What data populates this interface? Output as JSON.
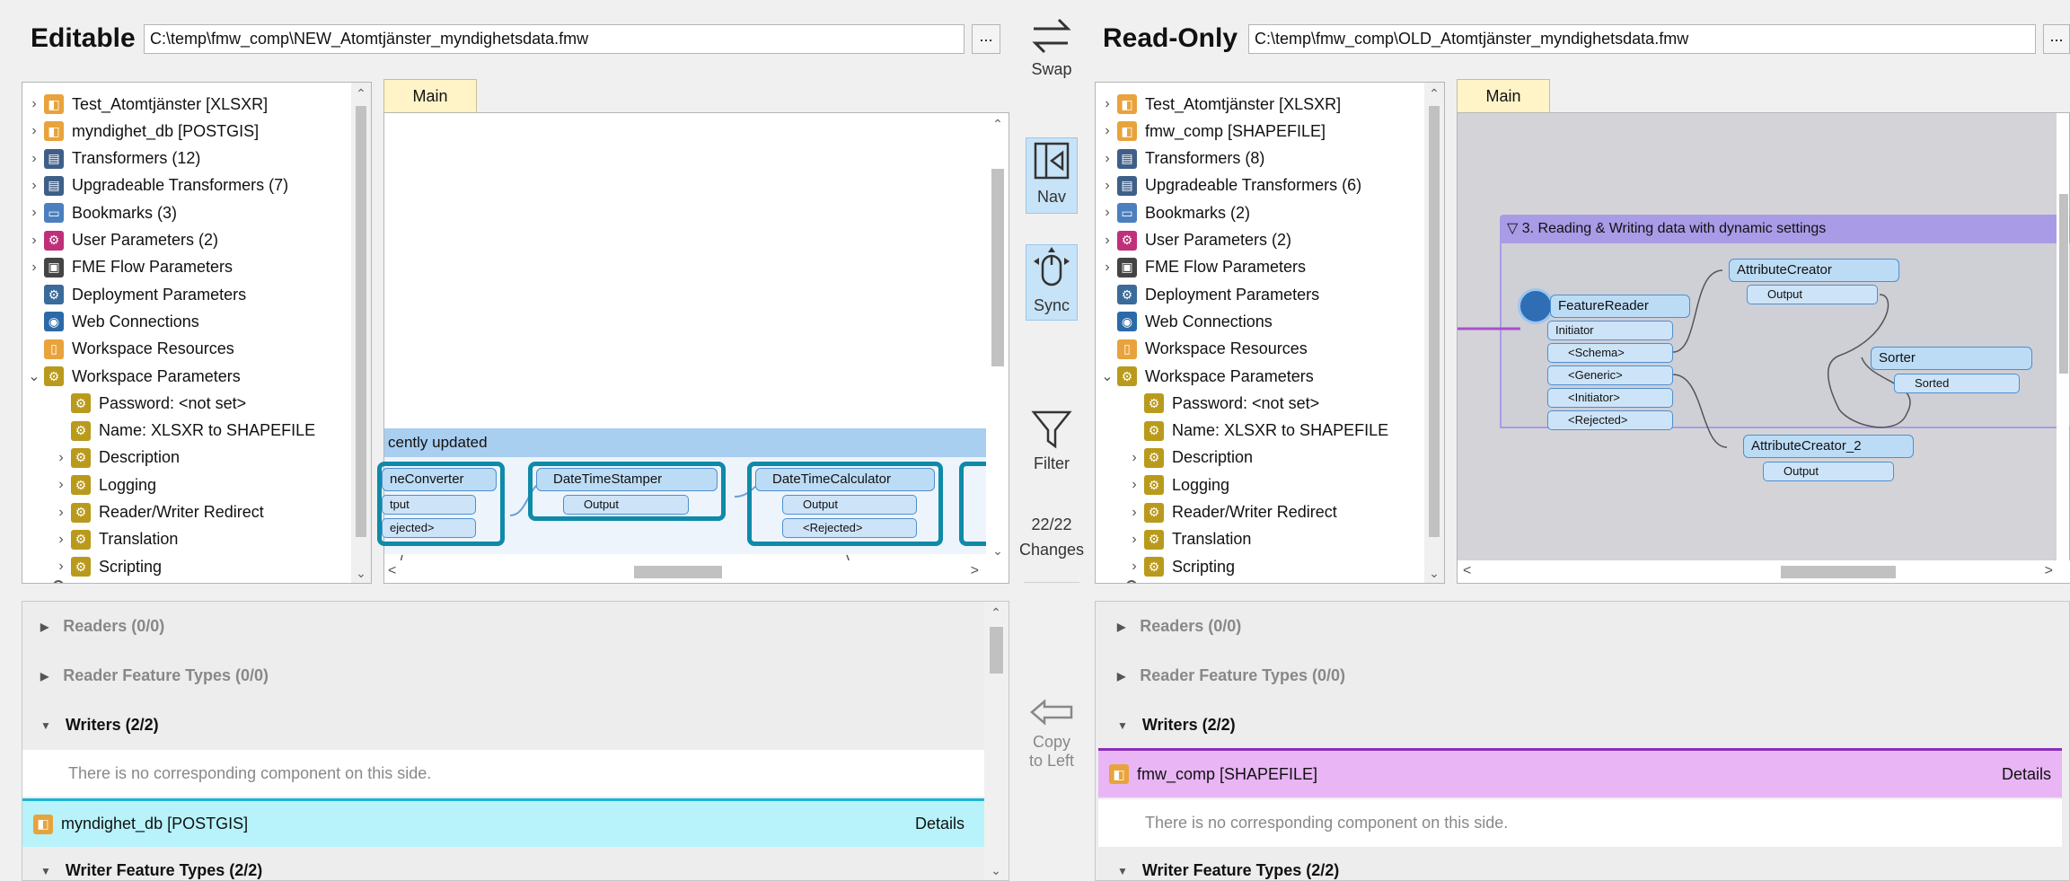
{
  "left": {
    "title": "Editable",
    "path": "C:\\temp\\fmw_comp\\NEW_Atomtjänster_myndighetsdata.fmw",
    "browse": "...",
    "tree": [
      {
        "label": "Test_Atomtjänster [XLSXR]",
        "chev": ">"
      },
      {
        "label": "myndighet_db [POSTGIS]",
        "chev": ">"
      },
      {
        "label": "Transformers (12)",
        "chev": ">"
      },
      {
        "label": "Upgradeable Transformers (7)",
        "chev": ">"
      },
      {
        "label": "Bookmarks (3)",
        "chev": ">"
      },
      {
        "label": "User Parameters (2)",
        "chev": ">"
      },
      {
        "label": "FME Flow Parameters",
        "chev": ">"
      },
      {
        "label": "Deployment Parameters",
        "chev": ""
      },
      {
        "label": "Web Connections",
        "chev": ""
      },
      {
        "label": "Workspace Resources",
        "chev": ""
      },
      {
        "label": "Workspace Parameters",
        "chev": "v"
      },
      {
        "label": "Password: <not set>",
        "chev": ""
      },
      {
        "label": "Name: XLSXR to SHAPEFILE",
        "chev": ""
      },
      {
        "label": "Description",
        "chev": ">"
      },
      {
        "label": "Logging",
        "chev": ">"
      },
      {
        "label": "Reader/Writer Redirect",
        "chev": ">"
      },
      {
        "label": "Translation",
        "chev": ">"
      },
      {
        "label": "Scripting",
        "chev": ">"
      }
    ],
    "tab": "Main",
    "canvas": {
      "bookmark": "cently updated",
      "node1": "neConverter",
      "node1_ports": [
        "tput",
        "ejected>"
      ],
      "node2": "DateTimeStamper",
      "node2_ports": [
        "Output"
      ],
      "node3": "DateTimeCalculator",
      "node3_ports": [
        "Output",
        "<Rejected>"
      ]
    },
    "sections": {
      "readers": "Readers (0/0)",
      "reader_ft": "Reader Feature Types (0/0)",
      "writers": "Writers (2/2)",
      "no_comp": "There is no corresponding component on this side.",
      "writer_item": "myndighet_db [POSTGIS]",
      "details": "Details",
      "writer_ft": "Writer Feature Types (2/2)"
    }
  },
  "center": {
    "swap": "Swap",
    "nav": "Nav",
    "sync": "Sync",
    "filter": "Filter",
    "changes_count": "22/22",
    "changes": "Changes",
    "copy": "Copy",
    "to_left": "to Left"
  },
  "right": {
    "title": "Read-Only",
    "path": "C:\\temp\\fmw_comp\\OLD_Atomtjänster_myndighetsdata.fmw",
    "browse": "...",
    "tree": [
      {
        "label": "Test_Atomtjänster [XLSXR]",
        "chev": ">"
      },
      {
        "label": "fmw_comp [SHAPEFILE]",
        "chev": ">"
      },
      {
        "label": "Transformers (8)",
        "chev": ">"
      },
      {
        "label": "Upgradeable Transformers (6)",
        "chev": ">"
      },
      {
        "label": "Bookmarks (2)",
        "chev": ">"
      },
      {
        "label": "User Parameters (2)",
        "chev": ">"
      },
      {
        "label": "FME Flow Parameters",
        "chev": ">"
      },
      {
        "label": "Deployment Parameters",
        "chev": ""
      },
      {
        "label": "Web Connections",
        "chev": ""
      },
      {
        "label": "Workspace Resources",
        "chev": ""
      },
      {
        "label": "Workspace Parameters",
        "chev": "v"
      },
      {
        "label": "Password: <not set>",
        "chev": ""
      },
      {
        "label": "Name: XLSXR to SHAPEFILE",
        "chev": ""
      },
      {
        "label": "Description",
        "chev": ">"
      },
      {
        "label": "Logging",
        "chev": ">"
      },
      {
        "label": "Reader/Writer Redirect",
        "chev": ">"
      },
      {
        "label": "Translation",
        "chev": ">"
      },
      {
        "label": "Scripting",
        "chev": ">"
      }
    ],
    "tab": "Main",
    "canvas": {
      "bookmark": "3. Reading & Writing data with dynamic settings",
      "featurereader": "FeatureReader",
      "fr_ports": [
        "Initiator",
        "<Schema>",
        "<Generic>",
        "<Initiator>",
        "<Rejected>"
      ],
      "attrcreator": "AttributeCreator",
      "ac_ports": [
        "Output"
      ],
      "sorter": "Sorter",
      "sorter_ports": [
        "Sorted"
      ],
      "attrcreator2": "AttributeCreator_2",
      "ac2_ports": [
        "Output"
      ]
    },
    "sections": {
      "readers": "Readers (0/0)",
      "reader_ft": "Reader Feature Types (0/0)",
      "writers": "Writers (2/2)",
      "writer_item": "fmw_comp [SHAPEFILE]",
      "details": "Details",
      "no_comp": "There is no corresponding component on this side.",
      "writer_ft": "Writer Feature Types (2/2)"
    }
  },
  "colors": {
    "added_row": "#b8f3fb",
    "removed_row": "#e9b5f5",
    "canvas_bg": "#d4d4d8",
    "bookmark_left": "#a8cef0",
    "bookmark_right": "#a99be6"
  }
}
